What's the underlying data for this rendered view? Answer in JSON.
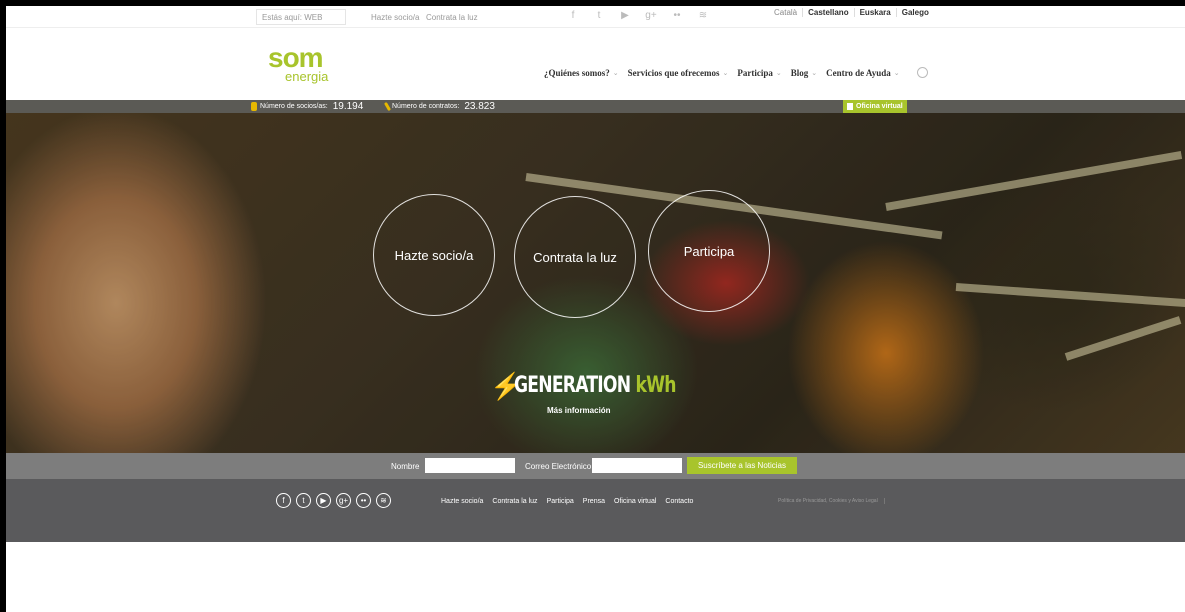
{
  "topbar": {
    "breadcrumb": "Estás aquí: WEB",
    "links": [
      "Hazte socio/a",
      "Contrata la luz"
    ],
    "social": [
      "facebook-icon",
      "twitter-icon",
      "youtube-icon",
      "googleplus-icon",
      "flickr-icon",
      "rss-icon"
    ],
    "social_glyphs": [
      "f",
      "t",
      "▶",
      "g+",
      "••",
      "≋"
    ],
    "languages": [
      "Català",
      "Castellano",
      "Euskara",
      "Galego"
    ]
  },
  "header": {
    "logo": {
      "som": "som",
      "energia": "energia"
    },
    "nav": [
      {
        "label": "¿Quiénes somos?",
        "dropdown": true
      },
      {
        "label": "Servicios que ofrecemos",
        "dropdown": true
      },
      {
        "label": "Participa",
        "dropdown": true
      },
      {
        "label": "Blog",
        "dropdown": true
      },
      {
        "label": "Centro de Ayuda",
        "dropdown": true
      }
    ]
  },
  "counters": {
    "members_label": "Número de socios/as:",
    "members_value": "19.194",
    "contracts_label": "Número de contratos:",
    "contracts_value": "23.823",
    "virtual_office": "Oficina virtual"
  },
  "hero": {
    "circles": [
      "Hazte socio/a",
      "Contrata la luz",
      "Participa"
    ],
    "generation_main": "GENERATION ",
    "generation_kwh": "kWh",
    "more_info": "Más información"
  },
  "newsletter": {
    "name_label": "Nombre",
    "email_label": "Correo Electrónico",
    "name_value": "",
    "email_value": "",
    "button": "Suscríbete a las Noticias"
  },
  "footer": {
    "social": [
      "facebook-icon",
      "twitter-icon",
      "youtube-icon",
      "googleplus-icon",
      "flickr-icon",
      "rss-icon"
    ],
    "social_glyphs": [
      "f",
      "t",
      "▶",
      "g+",
      "••",
      "≋"
    ],
    "links": [
      "Hazte socio/a",
      "Contrata la luz",
      "Participa",
      "Prensa",
      "Oficina virtual",
      "Contacto"
    ],
    "legal": "Política de Privacidad, Cookies y Aviso Legal"
  },
  "colors": {
    "accent": "#a8c42c",
    "counter_bar": "#5b5a55",
    "newsletter_bar": "#7d7d7d",
    "footer": "#5a5a5c"
  }
}
